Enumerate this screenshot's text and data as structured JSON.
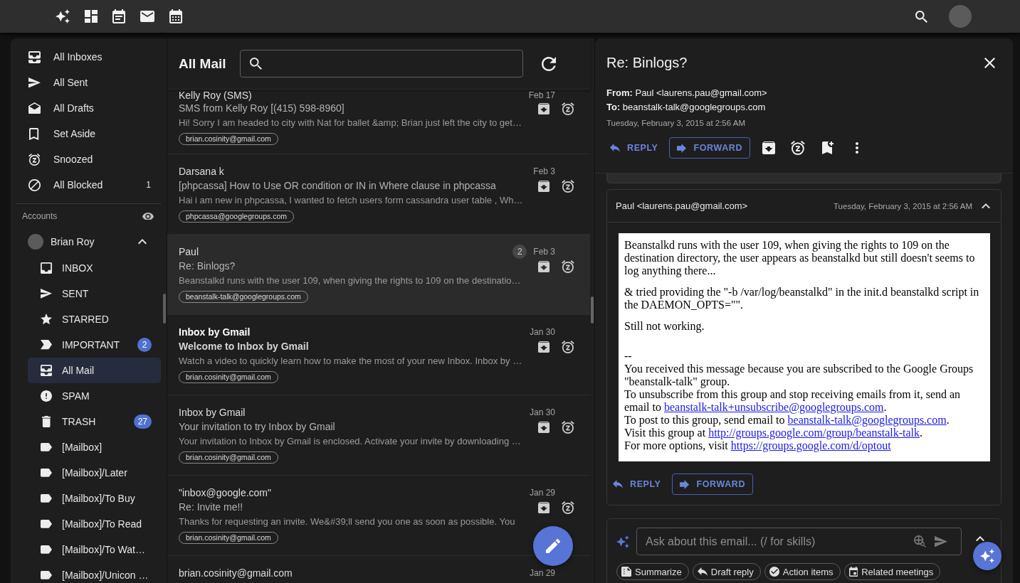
{
  "sidebar": {
    "items": [
      {
        "kind": "inboxes",
        "label": "All Inboxes",
        "selected": false
      },
      {
        "kind": "sent",
        "label": "All Sent",
        "selected": false
      },
      {
        "kind": "drafts",
        "label": "All Drafts",
        "selected": false
      },
      {
        "kind": "aside",
        "label": "Set Aside",
        "selected": false
      },
      {
        "kind": "snoozed",
        "label": "Snoozed",
        "selected": false
      },
      {
        "kind": "blocked",
        "label": "All Blocked",
        "count": "1",
        "selected": false
      }
    ],
    "accounts_heading": "Accounts",
    "accounts": [
      {
        "name": "Brian Roy",
        "expanded": true,
        "folders": [
          {
            "kind": "inbox",
            "label": "INBOX",
            "selected": false
          },
          {
            "kind": "sent",
            "label": "SENT",
            "selected": false
          },
          {
            "kind": "starred",
            "label": "STARRED",
            "selected": false
          },
          {
            "kind": "important",
            "label": "IMPORTANT",
            "badge": "2",
            "selected": false
          },
          {
            "kind": "allmail",
            "label": "All Mail",
            "selected": true
          },
          {
            "kind": "spam",
            "label": "SPAM",
            "selected": false
          },
          {
            "kind": "trash",
            "label": "TRASH",
            "badge": "27",
            "selected": false
          },
          {
            "kind": "label",
            "label": "[Mailbox]",
            "selected": false
          },
          {
            "kind": "label",
            "label": "[Mailbox]/Later",
            "selected": false
          },
          {
            "kind": "label",
            "label": "[Mailbox]/To Buy",
            "selected": false
          },
          {
            "kind": "label",
            "label": "[Mailbox]/To Read",
            "selected": false
          },
          {
            "kind": "label",
            "label": "[Mailbox]/To Wat…",
            "selected": false
          },
          {
            "kind": "label",
            "label": "[Mailbox]/Unicon …",
            "selected": false
          }
        ]
      }
    ]
  },
  "mail_list": {
    "title": "All Mail",
    "rows": [
      {
        "sender": "Kelly Roy (SMS)",
        "date": "Feb 17",
        "subject": "SMS from Kelly Roy [(415) 598-8960]",
        "snippet": "Hi! Sorry I am headed to city with Nat for ballet &amp; Brian just left the city to get…",
        "tag": "brian.cosinity@gmail.com",
        "unread": false,
        "selected": false
      },
      {
        "sender": "Darsana k",
        "date": "Feb 3",
        "subject": "[phpcassa] How to Use OR condition or IN in Where clause in phpcassa",
        "snippet": "Hai i am new in phpcassa, I wanted to fetch users form cassandra user table , Wh…",
        "tag": "phpcassa@googlegroups.com",
        "unread": false,
        "selected": false
      },
      {
        "sender": "Paul",
        "count": "2",
        "date": "Feb 3",
        "subject": "Re: Binlogs?",
        "snippet": "Beanstalkd runs with the user 109, when giving the rights to 109 on the destinatio…",
        "tag": "beanstalk-talk@googlegroups.com",
        "unread": false,
        "selected": true
      },
      {
        "sender": "Inbox by Gmail",
        "date": "Jan 30",
        "subject": "Welcome to Inbox by Gmail",
        "snippet": "Watch a video to quickly learn how to make the most of your new Inbox. Inbox by …",
        "tag": "brian.cosinity@gmail.com",
        "unread": true,
        "selected": false
      },
      {
        "sender": "Inbox by Gmail",
        "date": "Jan 30",
        "subject": "Your invitation to try Inbox by Gmail",
        "snippet": "Your invitation to Inbox by Gmail is enclosed. Activate your invite by downloading …",
        "tag": "brian.cosinity@gmail.com",
        "unread": false,
        "selected": false
      },
      {
        "sender": "\"inbox@google.com\"",
        "date": "Jan 29",
        "subject": "Re: Invite me!!",
        "snippet": "Thanks for requesting an invite. We&#39;ll send you one as soon as possible. You",
        "tag": "brian.cosinity@gmail.com",
        "unread": false,
        "selected": false
      },
      {
        "sender": "brian.cosinity@gmail.com",
        "date": "Jan 29",
        "unread": false,
        "selected": false
      }
    ]
  },
  "reader": {
    "subject": "Re: Binlogs?",
    "from": "**From:** Paul <laurens.pau@gmail.com>",
    "to": "**To:** beanstalk-talk@googlegroups.com",
    "date": "Tuesday, February 3, 2015 at 2:56 AM",
    "actions": [
      {
        "kind": "reply",
        "label": "REPLY"
      },
      {
        "kind": "forward",
        "label": "FORWARD"
      }
    ],
    "messages": [
      {
        "expanded": false
      },
      {
        "expanded": true,
        "from": "Paul <laurens.pau@gmail.com>",
        "date": "Tuesday, February 3, 2015 at 2:56 AM",
        "body": [
          {
            "kind": "text",
            "lines": [
              [
                {
                  "text": "Beanstalkd runs with the user 109, when giving the rights to 109 on the destination directory, the user appears as beanstalkd but still doesn't seems to log anything there..."
                }
              ]
            ]
          },
          {
            "kind": "text",
            "lines": [
              [
                {
                  "text": "& tried providing the \"-b /var/log/beanstalkd\" in the init.d beanstalkd script in the DAEMON_OPTS=\"\"."
                }
              ]
            ]
          },
          {
            "kind": "text",
            "lines": [
              [
                {
                  "text": "Still not working."
                }
              ]
            ]
          },
          {
            "kind": "signature",
            "lines": [
              [
                {
                  "text": "--"
                }
              ],
              [
                {
                  "text": "You received this message because you are subscribed to the Google Groups \"beanstalk-talk\" group."
                }
              ],
              [
                {
                  "text": "To unsubscribe from this group and stop receiving emails from it, send an email to "
                },
                {
                  "link": "beanstalk-talk+unsubscribe@googlegroups.com"
                },
                {
                  "text": "."
                }
              ],
              [
                {
                  "text": "To post to this group, send email to "
                },
                {
                  "link": "beanstalk-talk@googlegroups.com"
                },
                {
                  "text": "."
                }
              ],
              [
                {
                  "text": "Visit this group at "
                },
                {
                  "link": "http://groups.google.com/group/beanstalk-talk"
                },
                {
                  "text": "."
                }
              ],
              [
                {
                  "text": "For more options, visit "
                },
                {
                  "link": "https://groups.google.com/d/optout"
                }
              ]
            ]
          }
        ],
        "actions": [
          {
            "kind": "reply",
            "label": "REPLY"
          },
          {
            "kind": "forward",
            "label": "FORWARD"
          }
        ]
      }
    ],
    "assistant": {
      "placeholder": "Ask about this email... (/ for skills)",
      "suggestions": [
        {
          "kind": "summarize",
          "label": "Summarize"
        },
        {
          "kind": "draft",
          "label": "Draft reply"
        },
        {
          "kind": "actions",
          "label": "Action items"
        },
        {
          "kind": "meetings",
          "label": "Related meetings"
        }
      ]
    }
  }
}
